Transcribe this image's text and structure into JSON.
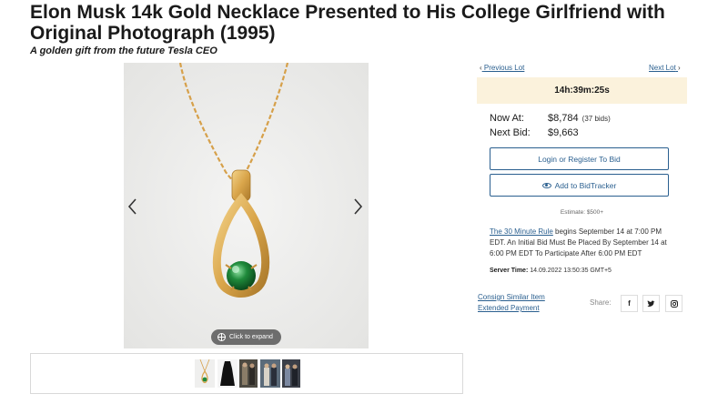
{
  "lot": {
    "title": "Elon Musk 14k Gold Necklace Presented to His College Girlfriend with Original Photograph (1995)",
    "subtitle": "A golden gift from the future Tesla CEO"
  },
  "gallery": {
    "expand_label": "Click to expand",
    "thumbnails": [
      "thumb-necklace",
      "thumb-black-dress",
      "thumb-couple-photo-1",
      "thumb-couple-photo-2",
      "thumb-couple-photo-3"
    ]
  },
  "navigation": {
    "prev_label": "Previous Lot",
    "next_label": "Next Lot"
  },
  "bidding": {
    "countdown": "14h:39m:25s",
    "now_at_label": "Now At:",
    "now_at_value": "$8,784",
    "bid_count": "(37 bids)",
    "next_bid_label": "Next Bid:",
    "next_bid_value": "$9,663",
    "login_button": "Login or Register To Bid",
    "bidtracker_button": "Add to BidTracker",
    "estimate": "Estimate: $500+"
  },
  "rules": {
    "link_text": "The 30 Minute Rule",
    "body_text": " begins September 14 at 7:00 PM EDT. An Initial Bid Must Be Placed By September 14 at 6:00 PM EDT To Participate After 6:00 PM EDT",
    "server_time_label": "Server Time:",
    "server_time_value": "14.09.2022 13:50:35 GMT+5"
  },
  "footer_links": {
    "consign": "Consign Similar Item",
    "extended_payment": "Extended Payment",
    "share_label": "Share:",
    "share_icons": [
      "facebook-icon",
      "twitter-icon",
      "instagram-icon"
    ]
  },
  "colors": {
    "link": "#2a5f8f",
    "timer_bg": "#fbf2dc",
    "gallery_bg": "#ececeb",
    "gold": "#d9a54a",
    "emerald": "#1f8a3b"
  }
}
